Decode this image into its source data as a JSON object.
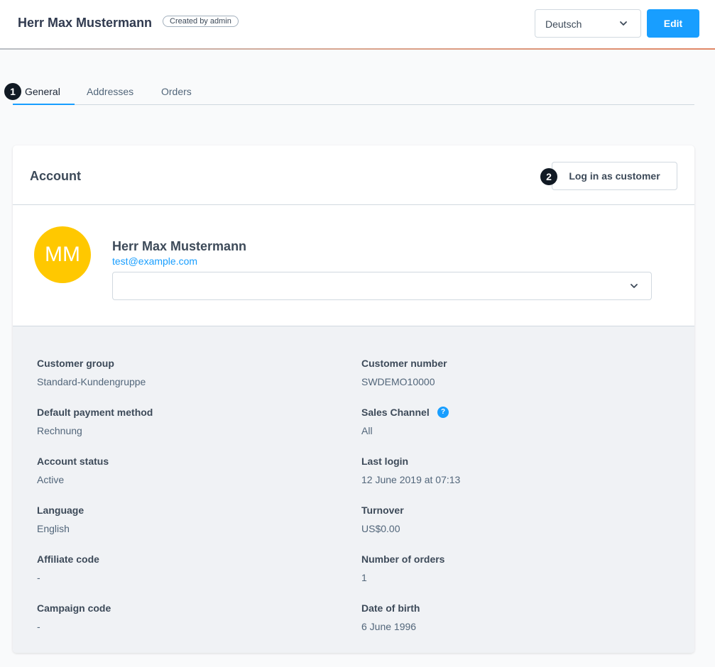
{
  "header": {
    "title": "Herr Max Mustermann",
    "badge": "Created by admin",
    "language_select": {
      "value": "Deutsch"
    },
    "edit_label": "Edit"
  },
  "tabs": [
    {
      "label": "General",
      "active": true
    },
    {
      "label": "Addresses",
      "active": false
    },
    {
      "label": "Orders",
      "active": false
    }
  ],
  "steps": [
    "1",
    "2"
  ],
  "account": {
    "title": "Account",
    "login_button": "Log in as customer",
    "avatar_initials": "MM",
    "avatar_color": "#ffc800",
    "name": "Herr Max Mustermann",
    "email": "test@example.com",
    "tag_select_value": ""
  },
  "fields": {
    "left": [
      {
        "label": "Customer group",
        "value": "Standard-Kundengruppe"
      },
      {
        "label": "Default payment method",
        "value": "Rechnung"
      },
      {
        "label": "Account status",
        "value": "Active"
      },
      {
        "label": "Language",
        "value": "English"
      },
      {
        "label": "Affiliate code",
        "value": "-"
      },
      {
        "label": "Campaign code",
        "value": "-"
      }
    ],
    "right": [
      {
        "label": "Customer number",
        "value": "SWDEMO10000"
      },
      {
        "label": "Sales Channel",
        "value": "All"
      },
      {
        "label": "Last login",
        "value": "12 June 2019 at 07:13"
      },
      {
        "label": "Turnover",
        "value": "US$0.00"
      },
      {
        "label": "Number of orders",
        "value": "1"
      },
      {
        "label": "Date of birth",
        "value": "6 June 1996"
      }
    ]
  },
  "help_icon": "question-mark-icon",
  "colors": {
    "primary": "#189eff",
    "text": "#3d4a59"
  }
}
